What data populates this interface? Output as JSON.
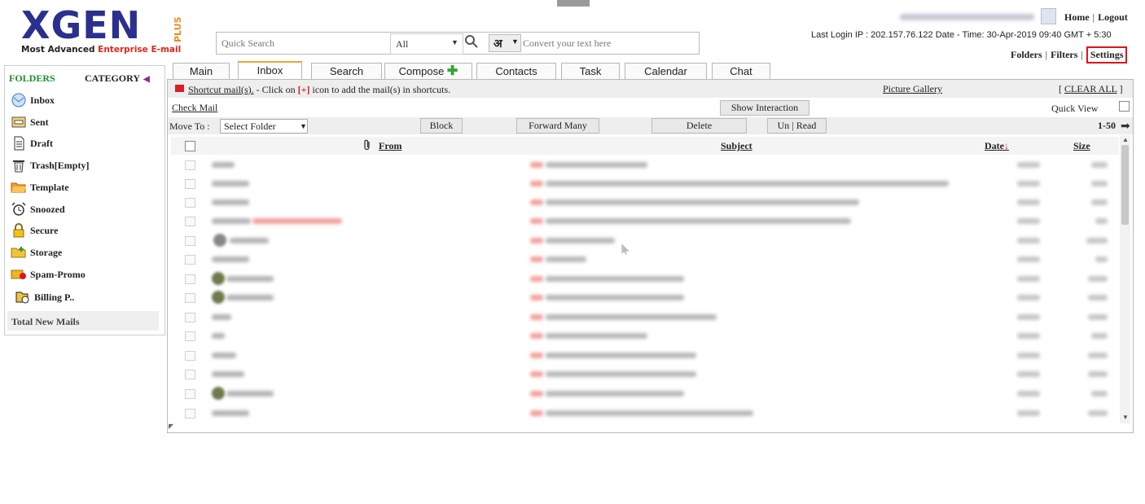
{
  "logo": {
    "brand": "XGEN",
    "plus": "PLUS",
    "tagline_a": "Most Advanced ",
    "tagline_b": "Enterprise E-mail"
  },
  "search": {
    "placeholder": "Quick Search",
    "filter_value": "All",
    "hindi_char": "अ",
    "convert_placeholder": "Convert your text here"
  },
  "header": {
    "home": "Home",
    "logout": "Logout",
    "last_login": "Last Login IP : 202.157.76.122 Date - Time: 30-Apr-2019 09:40 GMT + 5:30",
    "folders": "Folders",
    "filters": "Filters",
    "settings": "Settings"
  },
  "sidebar": {
    "folders_label": "FOLDERS",
    "category_label": "CATEGORY",
    "items": [
      {
        "label": "Inbox",
        "icon": "inbox-icon"
      },
      {
        "label": "Sent",
        "icon": "sent-icon"
      },
      {
        "label": "Draft",
        "icon": "draft-icon"
      },
      {
        "label": "Trash[Empty]",
        "icon": "trash-icon"
      },
      {
        "label": "Template",
        "icon": "template-folder-icon"
      },
      {
        "label": "Snoozed",
        "icon": "alarm-clock-icon"
      },
      {
        "label": "Secure",
        "icon": "lock-icon"
      },
      {
        "label": "Storage",
        "icon": "storage-folder-icon"
      },
      {
        "label": "Spam-Promo",
        "icon": "spam-icon"
      },
      {
        "label": "Billing P..",
        "icon": "billing-icon"
      }
    ],
    "total_new": "Total New Mails"
  },
  "tabs": [
    "Main",
    "Inbox",
    "Search",
    "Compose",
    "Contacts",
    "Task",
    "Calendar",
    "Chat"
  ],
  "active_tab": "Inbox",
  "toolbar": {
    "shortcut_link": "Shortcut mail(s).",
    "shortcut_text_a": " - Click on ",
    "shortcut_plus": "[+]",
    "shortcut_text_b": " icon to add the mail(s) in shortcuts.",
    "picture_gallery": "Picture Gallery",
    "clear_all": "CLEAR ALL",
    "check_mail": "Check Mail",
    "show_interaction": "Show Interaction",
    "quick_view": "Quick View",
    "move_to": "Move To :",
    "select_folder": "Select Folder",
    "block": "Block",
    "forward_many": "Forward Many",
    "delete": "Delete",
    "unread": "Un | Read",
    "range": "1-50"
  },
  "columns": {
    "from": "From",
    "subject": "Subject",
    "date": "Date",
    "size": "Size"
  },
  "colors": {
    "brand_blue": "#2b2f8e",
    "brand_orange": "#f08a1c",
    "folders_green": "#1b8f2b",
    "highlight_red": "#e0121f",
    "tab_active": "#f3a33a"
  }
}
